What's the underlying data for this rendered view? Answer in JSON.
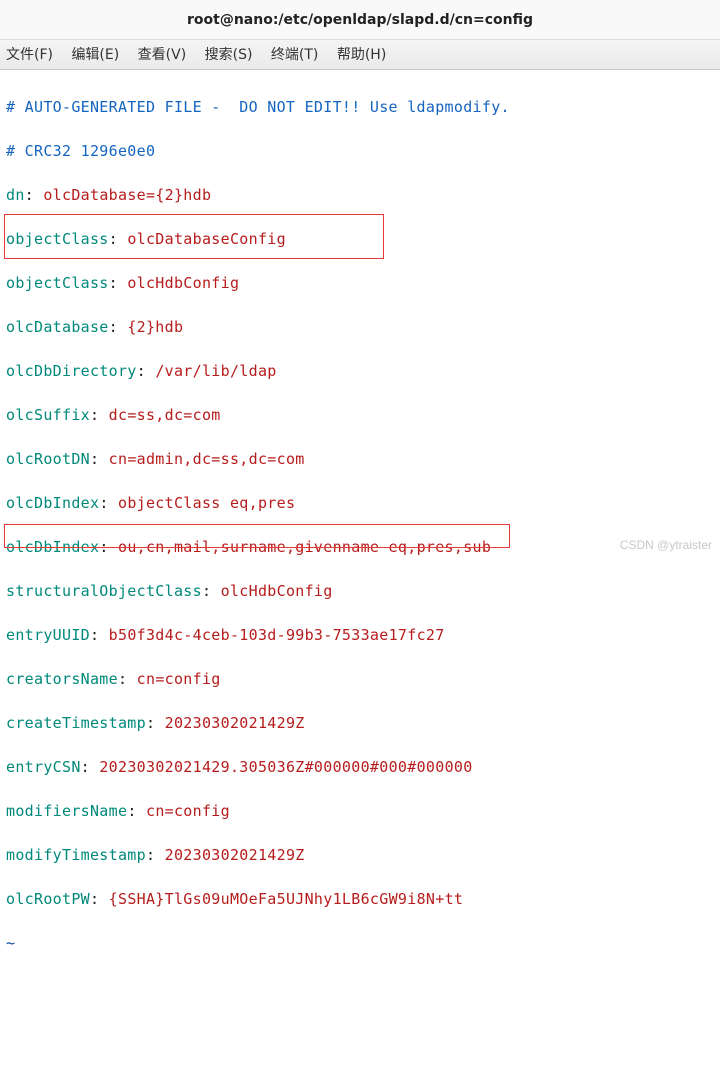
{
  "window": {
    "title": "root@nano:/etc/openldap/slapd.d/cn=config"
  },
  "menu": {
    "file": "文件(F)",
    "edit": "编辑(E)",
    "view": "查看(V)",
    "search": "搜索(S)",
    "terminal": "终端(T)",
    "help": "帮助(H)"
  },
  "lines": {
    "comment1": "# AUTO-GENERATED FILE -  DO NOT EDIT!! Use ldapmodify.",
    "comment2": "# CRC32 1296e0e0",
    "dn_k": "dn",
    "dn_v": "olcDatabase={2}hdb",
    "oc1_k": "objectClass",
    "oc1_v": "olcDatabaseConfig",
    "oc2_k": "objectClass",
    "oc2_v": "olcHdbConfig",
    "odb_k": "olcDatabase",
    "odb_v": "{2}hdb",
    "odir_k": "olcDbDirectory",
    "odir_v": "/var/lib/ldap",
    "osuf_k": "olcSuffix",
    "osuf_v": "dc=ss,dc=com",
    "ordn_k": "olcRootDN",
    "ordn_v": "cn=admin,dc=ss,dc=com",
    "oidx1_k": "olcDbIndex",
    "oidx1_v": "objectClass eq,pres",
    "oidx2_k": "olcDbIndex",
    "oidx2_v": "ou,cn,mail,surname,givenname eq,pres,sub",
    "soc_k": "structuralObjectClass",
    "soc_v": "olcHdbConfig",
    "euuid_k": "entryUUID",
    "euuid_v": "b50f3d4c-4ceb-103d-99b3-7533ae17fc27",
    "cname_k": "creatorsName",
    "cname_v": "cn=config",
    "cts_k": "createTimestamp",
    "cts_v": "20230302021429Z",
    "ecsn_k": "entryCSN",
    "ecsn_v": "20230302021429.305036Z#000000#000#000000",
    "mname_k": "modifiersName",
    "mname_v": "cn=config",
    "mts_k": "modifyTimestamp",
    "mts_v": "20230302021429Z",
    "orpw_k": "olcRootPW",
    "orpw_v": "{SSHA}TlGs09uMOeFa5UJNhy1LB6cGW9i8N+tt",
    "tilde": "~"
  },
  "watermark": "CSDN @ytraister"
}
